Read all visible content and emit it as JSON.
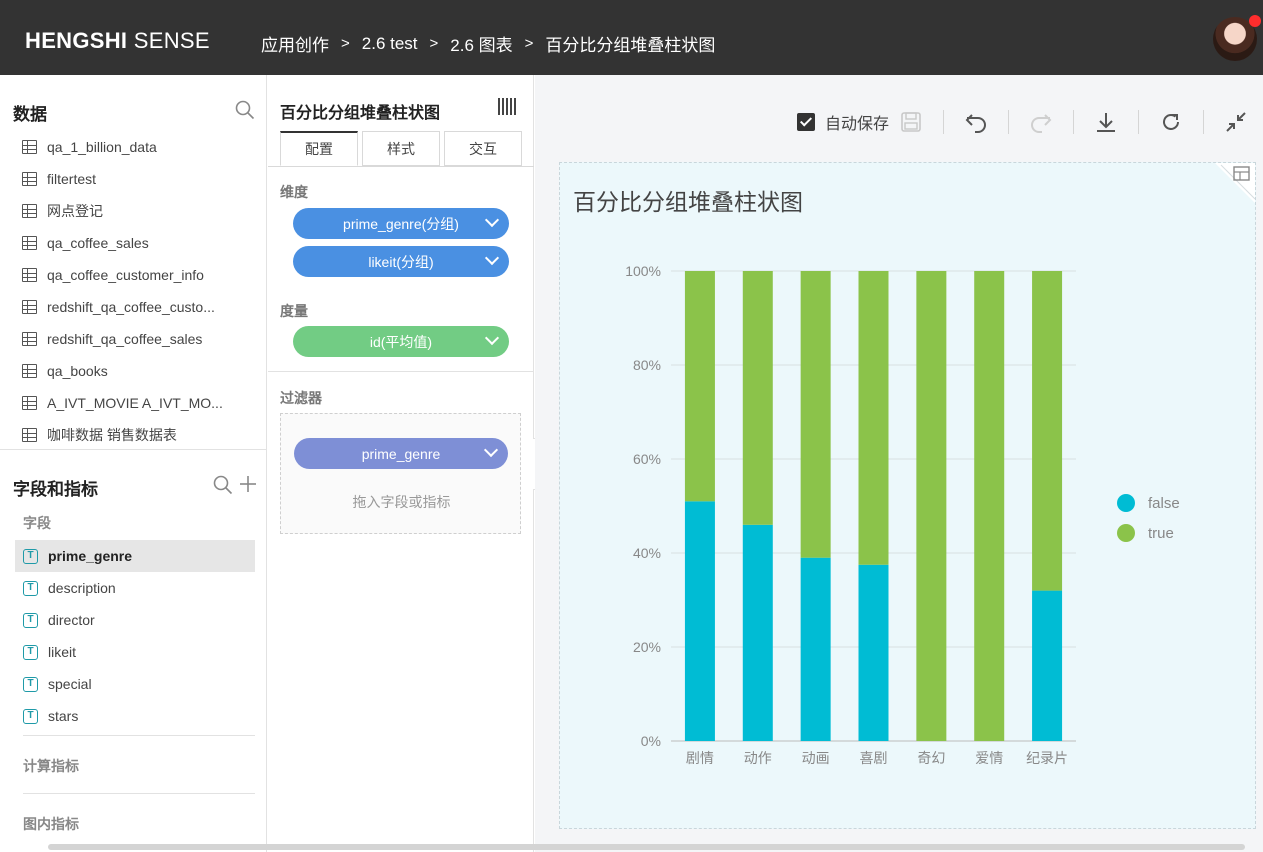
{
  "app": {
    "logo_bold": "HENGSHI",
    "logo_light": "SENSE"
  },
  "breadcrumb": [
    "应用创作",
    "2.6 test",
    "2.6 图表",
    "百分比分组堆叠柱状图"
  ],
  "breadcrumb_sep": ">",
  "data_panel": {
    "title": "数据",
    "datasets": [
      "qa_1_billion_data",
      "filtertest",
      "网点登记",
      "qa_coffee_sales",
      "qa_coffee_customer_info",
      "redshift_qa_coffee_custo...",
      "redshift_qa_coffee_sales",
      "qa_books",
      "A_IVT_MOVIE A_IVT_MO...",
      "咖啡数据 销售数据表"
    ]
  },
  "fields_panel": {
    "title": "字段和指标",
    "fields_label": "字段",
    "fields": [
      "prime_genre",
      "description",
      "director",
      "likeit",
      "special",
      "stars"
    ],
    "selected_field": "prime_genre",
    "calc_label": "计算指标",
    "inchart_label": "图内指标"
  },
  "config": {
    "title": "百分比分组堆叠柱状图",
    "tabs": [
      "配置",
      "样式",
      "交互"
    ],
    "dimension_label": "维度",
    "dimensions": [
      "prime_genre(分组)",
      "likeit(分组)"
    ],
    "measure_label": "度量",
    "measures": [
      "id(平均值)"
    ],
    "filter_label": "过滤器",
    "filters": [
      "prime_genre"
    ],
    "drop_hint": "拖入字段或指标"
  },
  "toolbar": {
    "autosave_label": "自动保存",
    "autosave_checked": true
  },
  "chart_data": {
    "type": "bar",
    "stacked": "percent",
    "title": "百分比分组堆叠柱状图",
    "categories": [
      "剧情",
      "动作",
      "动画",
      "喜剧",
      "奇幻",
      "爱情",
      "纪录片"
    ],
    "series": [
      {
        "name": "false",
        "color": "#00bcd4",
        "values": [
          51,
          46,
          39,
          37.5,
          0,
          0,
          32
        ]
      },
      {
        "name": "true",
        "color": "#8bc34a",
        "values": [
          49,
          54,
          61,
          62.5,
          100,
          100,
          68
        ]
      }
    ],
    "yticks": [
      "0%",
      "20%",
      "40%",
      "60%",
      "80%",
      "100%"
    ],
    "ylim": [
      0,
      100
    ],
    "legend_position": "right",
    "grid": true
  }
}
